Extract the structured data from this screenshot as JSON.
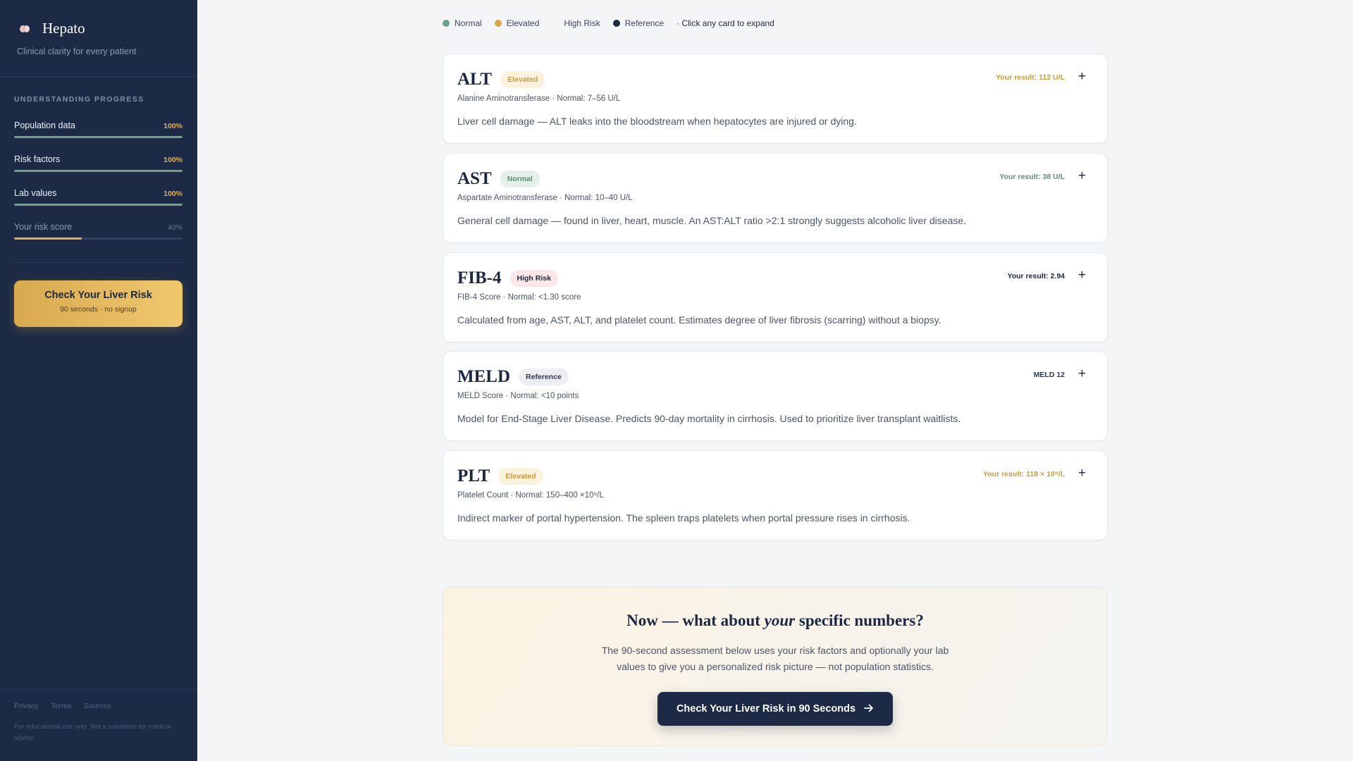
{
  "brand": {
    "name": "Hepato",
    "tagline": "Clinical clarity for every patient",
    "icon": "brain-icon"
  },
  "sidebar": {
    "section_title": "UNDERSTANDING PROGRESS",
    "progress": [
      {
        "label": "Population data",
        "percent_label": "100%",
        "value": 100
      },
      {
        "label": "Risk factors",
        "percent_label": "100%",
        "value": 100
      },
      {
        "label": "Lab values",
        "percent_label": "100%",
        "value": 100
      },
      {
        "label": "Your risk score",
        "percent_label": "40%",
        "value": 40
      }
    ],
    "cta": {
      "title": "Check Your Liver Risk",
      "subtitle": "90 seconds · no signup"
    },
    "footer_links": [
      "Privacy",
      "Terms",
      "Sources"
    ],
    "disclaimer": "For educational use only. Not a substitute for medical advice."
  },
  "legend": {
    "items": [
      {
        "label": "Normal",
        "color": "#6ea08a"
      },
      {
        "label": "Elevated",
        "color": "#d9a94f"
      },
      {
        "label": "High Risk",
        "color": ""
      },
      {
        "label": "Reference",
        "color": "#1c2740"
      }
    ],
    "note": "· Click any card to expand"
  },
  "cards": [
    {
      "abbr": "ALT",
      "badge": "Elevated",
      "status": "elevated",
      "subtitle": "Alanine Aminotransferase · Normal: 7–56 U/L",
      "description": "Liver cell damage — ALT leaks into the bloodstream when hepatocytes are injured or dying.",
      "result": "Your result: 112 U/L"
    },
    {
      "abbr": "AST",
      "badge": "Normal",
      "status": "normal",
      "subtitle": "Aspartate Aminotransferase · Normal: 10–40 U/L",
      "description": "General cell damage — found in liver, heart, muscle. An AST:ALT ratio >2:1 strongly suggests alcoholic liver disease.",
      "result": "Your result: 38 U/L"
    },
    {
      "abbr": "FIB-4",
      "badge": "High Risk",
      "status": "high",
      "subtitle": "FIB-4 Score · Normal: <1.30 score",
      "description": "Calculated from age, AST, ALT, and platelet count. Estimates degree of liver fibrosis (scarring) without a biopsy.",
      "result": "Your result: 2.94"
    },
    {
      "abbr": "MELD",
      "badge": "Reference",
      "status": "reference",
      "subtitle": "MELD Score · Normal: <10 points",
      "description": "Model for End-Stage Liver Disease. Predicts 90-day mortality in cirrhosis. Used to prioritize liver transplant waitlists.",
      "result": "MELD 12"
    },
    {
      "abbr": "PLT",
      "badge": "Elevated",
      "status": "elevated",
      "subtitle": "Platelet Count · Normal: 150–400 ×10⁹/L",
      "description": "Indirect marker of portal hypertension. The spleen traps platelets when portal pressure rises in cirrhosis.",
      "result": "Your result: 118 × 10⁹/L"
    }
  ],
  "cta_panel": {
    "heading_before": "Now — what about ",
    "heading_em": "your",
    "heading_after": " specific numbers?",
    "text": "The 90-second assessment below uses your risk factors and optionally your lab values to give you a personalized risk picture — not population statistics.",
    "button_label": "Check Your Liver Risk in 90 Seconds"
  }
}
